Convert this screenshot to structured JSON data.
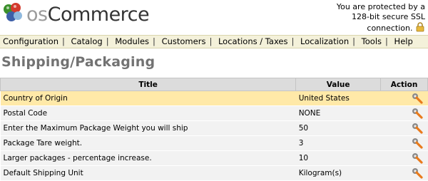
{
  "brand": {
    "prefix": "os",
    "name": "Commerce"
  },
  "ssl": {
    "line1": "You are protected by a",
    "line2": "128-bit secure SSL",
    "line3": "connection."
  },
  "menu": [
    "Configuration",
    "Catalog",
    "Modules",
    "Customers",
    "Locations / Taxes",
    "Localization",
    "Tools",
    "Help"
  ],
  "page_title": "Shipping/Packaging",
  "table": {
    "headers": {
      "title": "Title",
      "value": "Value",
      "action": "Action"
    },
    "rows": [
      {
        "title": "Country of Origin",
        "value": "United States",
        "selected": true
      },
      {
        "title": "Postal Code",
        "value": "NONE",
        "selected": false
      },
      {
        "title": "Enter the Maximum Package Weight you will ship",
        "value": "50",
        "selected": false
      },
      {
        "title": "Package Tare weight.",
        "value": "3",
        "selected": false
      },
      {
        "title": "Larger packages - percentage increase.",
        "value": "10",
        "selected": false
      },
      {
        "title": "Default Shipping Unit",
        "value": "Kilogram(s)",
        "selected": false
      }
    ]
  },
  "icons": {
    "logo": "oscommerce-logo-icon",
    "lock": "lock-icon",
    "edit": "wrench-edit-icon"
  }
}
